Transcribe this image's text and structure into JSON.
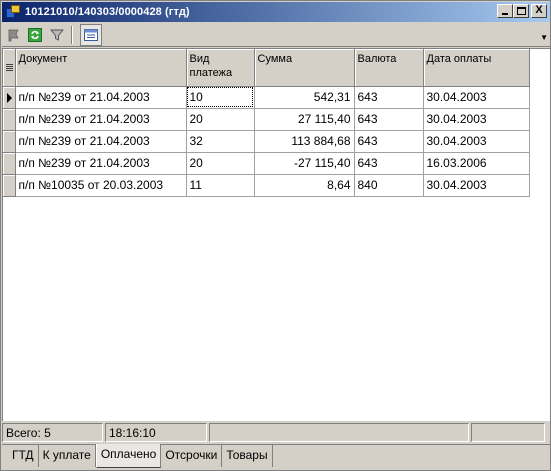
{
  "window": {
    "title": "10121010/140303/0000428 (гтд)",
    "controls": {
      "minimize": "_",
      "maximize": "□",
      "close": "X"
    }
  },
  "toolbar": {
    "items": [
      {
        "icon": "flag-icon"
      },
      {
        "icon": "refresh-icon"
      },
      {
        "icon": "filter-icon"
      },
      {
        "icon": "grid-settings-icon",
        "pressed": true
      }
    ],
    "dropdown": "▼"
  },
  "grid": {
    "columns": [
      {
        "label": "Документ"
      },
      {
        "label": "Вид платежа"
      },
      {
        "label": "Сумма"
      },
      {
        "label": "Валюта"
      },
      {
        "label": "Дата оплаты"
      }
    ],
    "rows": [
      {
        "document": "п/п №239 от 21.04.2003",
        "payment_type": "10",
        "amount": "542,31",
        "currency": "643",
        "pay_date": "30.04.2003",
        "current": true
      },
      {
        "document": "п/п №239 от 21.04.2003",
        "payment_type": "20",
        "amount": "27 115,40",
        "currency": "643",
        "pay_date": "30.04.2003"
      },
      {
        "document": "п/п №239 от 21.04.2003",
        "payment_type": "32",
        "amount": "113 884,68",
        "currency": "643",
        "pay_date": "30.04.2003"
      },
      {
        "document": "п/п №239 от 21.04.2003",
        "payment_type": "20",
        "amount": "-27 115,40",
        "currency": "643",
        "pay_date": "16.03.2006"
      },
      {
        "document": "п/п №10035 от 20.03.2003",
        "payment_type": "11",
        "amount": "8,64",
        "currency": "840",
        "pay_date": "30.04.2003"
      }
    ]
  },
  "status": {
    "total": "Всего: 5",
    "time": "18:16:10"
  },
  "tabs": [
    {
      "label": "ГТД"
    },
    {
      "label": "К уплате"
    },
    {
      "label": "Оплачено",
      "active": true
    },
    {
      "label": "Отсрочки"
    },
    {
      "label": "Товары"
    }
  ],
  "colors": {
    "title_gradient_start": "#0a246a",
    "title_gradient_end": "#a6caf0",
    "face": "#d4d0c8"
  }
}
